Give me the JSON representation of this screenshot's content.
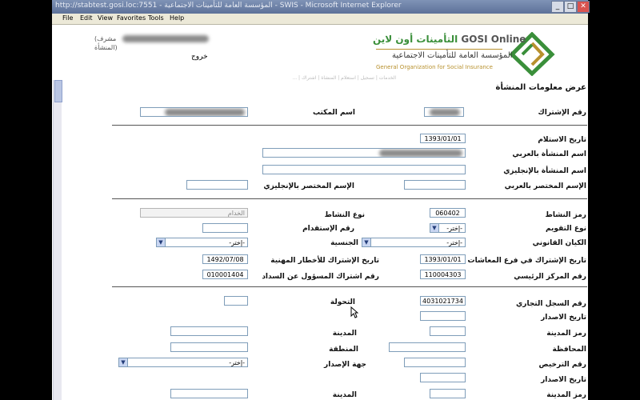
{
  "window": {
    "title": "http://stabtest.gosi.loc:7551 - المؤسسة العامة للتأمينات الاجتماعية - SWIS - Microsoft Internet Explorer",
    "minimize": "_",
    "maximize": "□",
    "close": "✕"
  },
  "menu": [
    "File",
    "Edit",
    "View",
    "Favorites",
    "Tools",
    "Help"
  ],
  "header": {
    "brand_ar": "التأمينات أون لاين",
    "brand_en": "GOSI Online",
    "org_ar": "المؤسسة العامة للتأمينات الاجتماعية",
    "org_en": "General Organization for Social Insurance",
    "user_role": "(مشرف",
    "user_role2": "المنشأة)",
    "logout": "خروج",
    "breadcrumb_faint": "الخدمات | تسجيل | استعلام | المنشأة | اشتراك | ..."
  },
  "page": {
    "title": "عرض معلومات المنشأة"
  },
  "fields": {
    "subscription_no_label": "رقم الإشتراك",
    "office_name_label": "اسم المكتب",
    "receive_date_label": "تاريخ الاستلام",
    "receive_date": "1393/01/01",
    "name_ar_label": "اسم المنشأة بالعربي",
    "name_en_label": "اسم المنشأة بالإنجليزي",
    "short_ar_label": "الإسم المختصر بالعربي",
    "short_en_label": "الإسم المختصر بالإنجليزي",
    "activity_code_label": "رمز النشاط",
    "activity_code": "060402",
    "activity_type_label": "نوع النشاط",
    "activity_type_value": "الخدام",
    "calendar_type_label": "نوع التقويم",
    "calendar_type": "-إختر-",
    "usage_no_label": "رقم الإستقدام",
    "legal_entity_label": "الكيان القانوني",
    "legal_entity": "-إختر-",
    "nationality_label": "الجنسية",
    "nationality": "-إختر-",
    "pension_date_label": "تاريخ الإشتراك في فرع المعاشات",
    "pension_date": "1393/01/01",
    "hazards_date_label": "تاريخ الإشتراك للأخطار المهنية",
    "hazards_date": "1492/07/08",
    "main_center_label": "رقم المركز الرئيسي",
    "main_center": "110004303",
    "payer_no_label": "رقم اشتراك المسؤول عن السداد",
    "payer_no": "010001404",
    "cr_no_label": "رقم السجل التجاري",
    "cr_no": "4031021734",
    "transfer_label": "التحولة",
    "issue_date_label": "تاريخ الاصدار",
    "city_code_label": "رمز المدينة",
    "city_label": "المدينة",
    "governorate_label": "المحافظة",
    "region_label": "المنطقة",
    "license_no_label": "رقم الترخيص",
    "issuer_label": "جهة الإصدار",
    "issuer": "-إختر-",
    "issue_date2_label": "تاريخ الاصدار",
    "city_code2_label": "رمز المدينة",
    "city2_label": "المدينة"
  },
  "colors": {
    "titlebar": "#6a7fa8",
    "menubar": "#ece9d8",
    "brand_green": "#3a8f3a",
    "brand_gold": "#b8912e"
  }
}
